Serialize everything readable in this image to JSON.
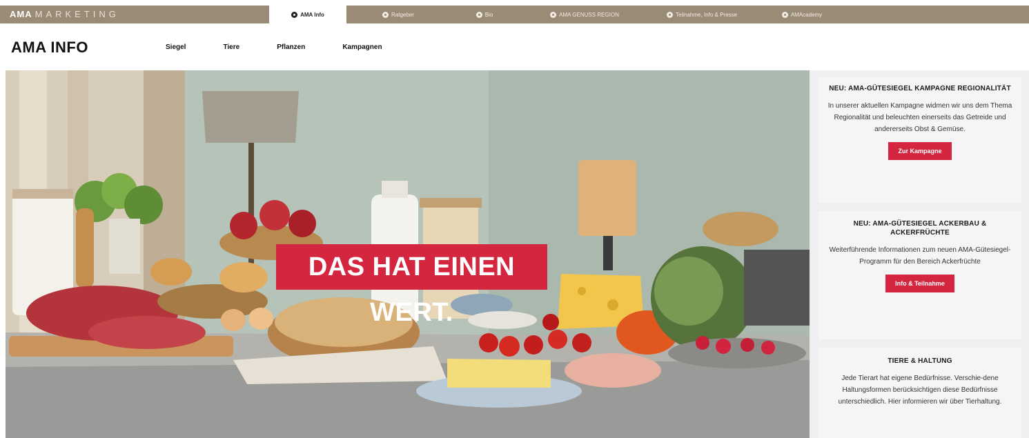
{
  "brand": {
    "bold": "AMA",
    "rest": "MARKETING"
  },
  "topnav": [
    {
      "label": "AMA Info",
      "icon": "info-icon",
      "active": true
    },
    {
      "label": "Ratgeber",
      "icon": "book-icon",
      "active": false
    },
    {
      "label": "Bio",
      "icon": "leaf-icon",
      "active": false
    },
    {
      "label": "AMA GENUSS REGION",
      "icon": "region-icon",
      "active": false
    },
    {
      "label": "Teilnahme, Info & Presse",
      "icon": "check-icon",
      "active": false
    },
    {
      "label": "AMAcademy",
      "icon": "academy-icon",
      "active": false
    }
  ],
  "header": {
    "title": "AMA INFO",
    "subnav": [
      "Siegel",
      "Tiere",
      "Pflanzen",
      "Kampagnen"
    ]
  },
  "hero": {
    "headline": "DAS HAT EINEN WERT."
  },
  "sidebar": {
    "cards": [
      {
        "title": "NEU: AMA-GÜTESIEGEL KAMPAGNE REGIONALITÄT",
        "text": "In unserer aktuellen Kampagne widmen wir uns dem Thema Regionalität und beleuchten einerseits das Getreide und andererseits Obst & Gemüse.",
        "button": "Zur Kampagne"
      },
      {
        "title": "NEU: AMA-GÜTESIEGEL ACKERBAU & ACKERFRÜCHTE",
        "text": "Weiterführende Informationen zum neuen AMA-Gütesiegel-Programm für den Bereich Ackerfrüchte",
        "button": "Info & Teilnahme"
      },
      {
        "title": "TIERE & HALTUNG",
        "text": "Jede Tierart hat eigene Bedürfnisse. Verschie-dene Haltungsformen berücksichtigen diese Bedürfnisse unterschiedlich. Hier informieren wir über Tierhaltung."
      }
    ]
  },
  "colors": {
    "topbar": "#9a8b76",
    "accent": "#d5263f",
    "sidebar_bg": "#efefef"
  }
}
